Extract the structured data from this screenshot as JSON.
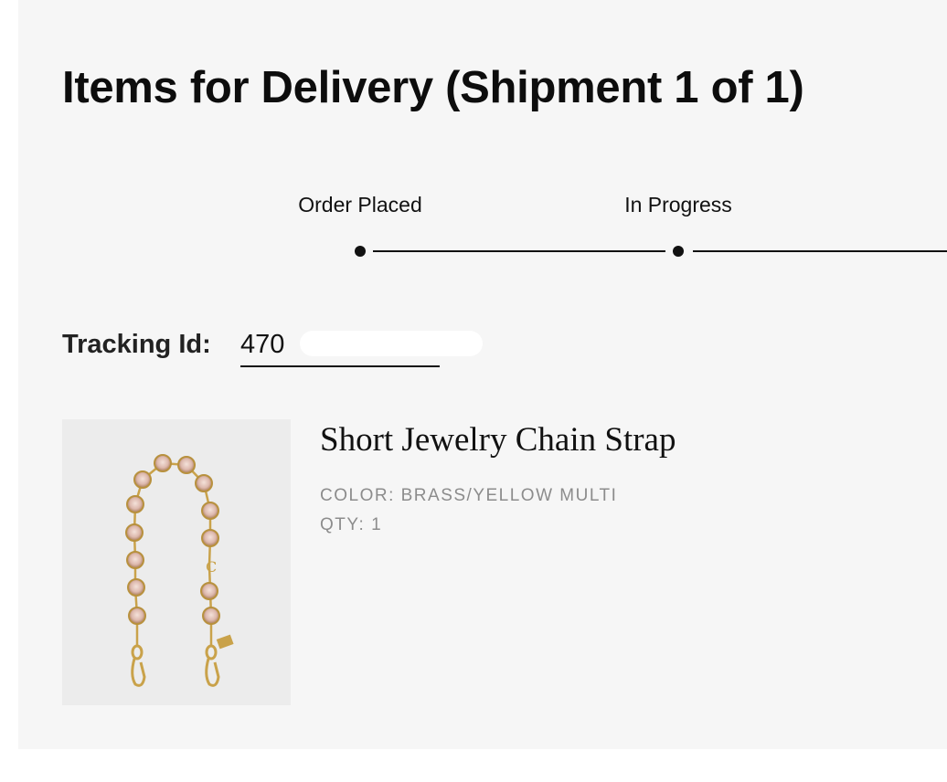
{
  "page": {
    "title": "Items for Delivery (Shipment 1 of 1)"
  },
  "progress": {
    "steps": [
      {
        "label": "Order Placed"
      },
      {
        "label": "In Progress"
      }
    ]
  },
  "tracking": {
    "label": "Tracking Id:",
    "value": "470"
  },
  "product": {
    "name": "Short Jewelry Chain Strap",
    "color_line": "COLOR: BRASS/YELLOW MULTI",
    "qty_line": "QTY: 1",
    "image_icon": "jewelry-chain-strap-image"
  },
  "colors": {
    "panel_background": "#f6f6f6",
    "text": "#111111",
    "meta_text": "#8c8c8c",
    "chain_gold": "#c9a24a",
    "crystal_pink": "#e8c8c0"
  }
}
